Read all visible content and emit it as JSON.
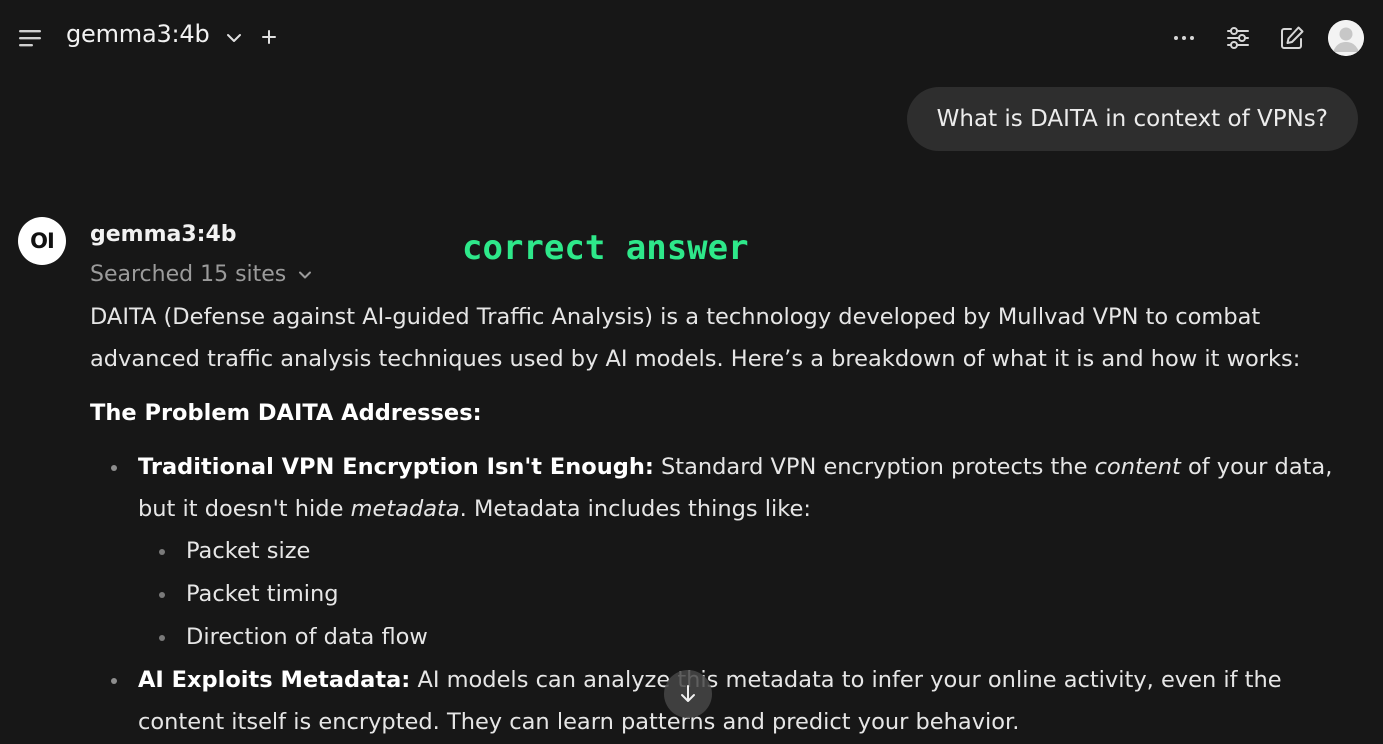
{
  "header": {
    "model_name": "gemma3:4b",
    "icons": {
      "menu": "menu-icon",
      "chevron": "chevron-down-icon",
      "add": "plus-icon",
      "more": "more-horizontal-icon",
      "controls": "sliders-icon",
      "new_chat": "edit-icon",
      "profile": "avatar"
    }
  },
  "user_message": {
    "text": "What is DAITA in context of VPNs?"
  },
  "assistant": {
    "logo_text": "OI",
    "model_name": "gemma3:4b",
    "search_status": "Searched 15 sites",
    "overlay_label": "correct answer",
    "intro": "DAITA (Defense against AI-guided Traffic Analysis) is a technology developed by Mullvad VPN to combat advanced traffic analysis techniques used by AI models. Here’s a breakdown of what it is and how it works:",
    "section_title": "The Problem DAITA Addresses:",
    "bullets": [
      {
        "lead": "Traditional VPN Encryption Isn't Enough:",
        "text_1": " Standard VPN encryption protects the ",
        "em_1": "content",
        "text_2": " of your data, but it doesn't hide ",
        "em_2": "metadata",
        "text_3": ". Metadata includes things like:",
        "sub_items": [
          "Packet size",
          "Packet timing",
          "Direction of data flow"
        ]
      },
      {
        "lead": "AI Exploits Metadata:",
        "text_1": " AI models can analyze this metadata to infer your online activity, even if the content itself is encrypted. They can learn patterns and predict your behavior."
      }
    ]
  },
  "colors": {
    "background": "#171717",
    "user_bubble": "#2e2e2e",
    "overlay_label": "#2ee88a",
    "muted_text": "#9b9b9b"
  }
}
